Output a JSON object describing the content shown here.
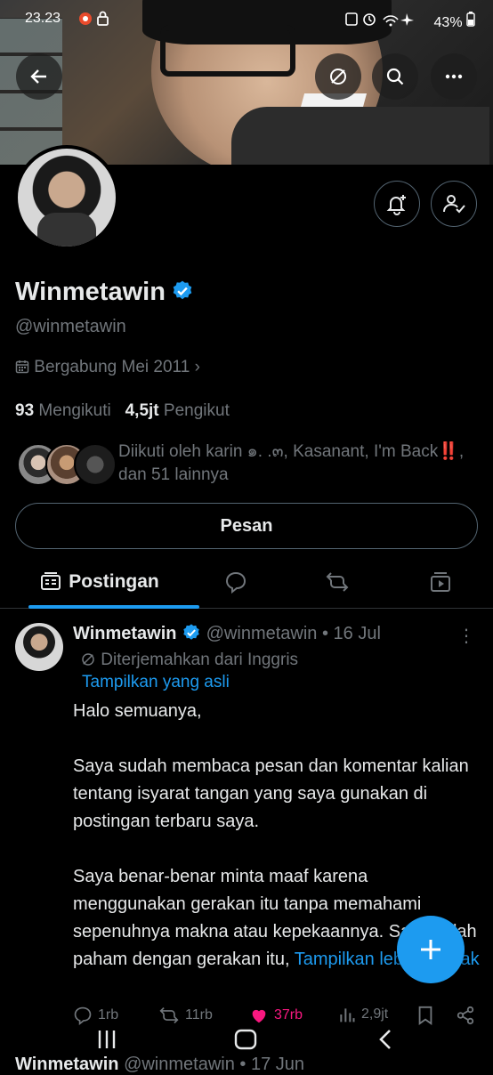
{
  "status_bar": {
    "time": "23.23",
    "battery": "43%"
  },
  "profile": {
    "name": "Winmetawin",
    "handle": "@winmetawin",
    "joined": "Bergabung Mei 2011",
    "following_count": "93",
    "following_label": "Mengikuti",
    "followers_count": "4,5jt",
    "followers_label": "Pengikut",
    "followed_by": "Diikuti oleh karin ๑. .๓, Kasanant, I'm Back‼️, dan 51 lainnya",
    "message_button": "Pesan"
  },
  "tabs": [
    {
      "label": "Postingan",
      "icon": "posts-icon"
    },
    {
      "label": "",
      "icon": "reply-icon"
    },
    {
      "label": "",
      "icon": "repost-icon"
    },
    {
      "label": "",
      "icon": "media-icon"
    }
  ],
  "post": {
    "author": "Winmetawin",
    "handle_date": "@winmetawin • 16 Jul",
    "translated_label": "Diterjemahkan dari Inggris",
    "show_original": "Tampilkan yang asli",
    "paragraph1": "Halo semuanya,",
    "paragraph2": "Saya sudah membaca pesan dan komentar kalian tentang isyarat tangan yang saya gunakan di postingan terbaru saya.",
    "paragraph3": "Saya benar-benar minta maaf karena menggunakan gerakan itu tanpa memahami sepenuhnya makna atau kepekaannya. Saya salah paham dengan gerakan itu,",
    "show_more": "Tampilkan lebih banyak",
    "replies": "1rb",
    "reposts": "11rb",
    "likes": "37rb",
    "views": "2,9jt"
  },
  "next_post": {
    "author": "Winmetawin",
    "handle_date": "@winmetawin • 17 Jun"
  },
  "colors": {
    "accent": "#1d9bf0",
    "like": "#f91880",
    "muted": "#71767b",
    "background": "#000000"
  }
}
